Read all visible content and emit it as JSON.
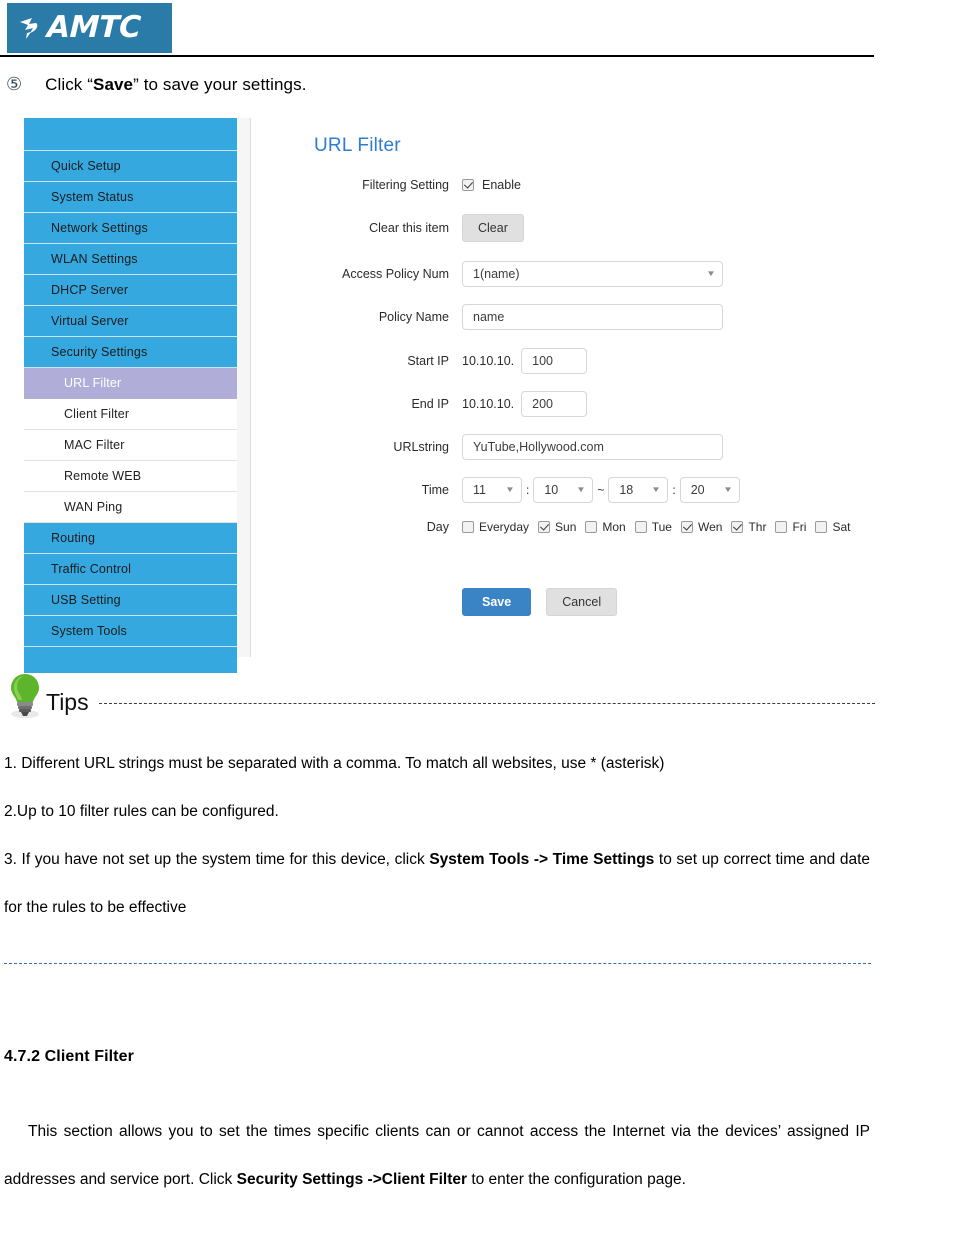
{
  "header": {
    "logo_text": "AMTC",
    "logo_bg": "#2b7ba8"
  },
  "step": {
    "number": "⑤",
    "text_before": "Click “",
    "bold": "Save",
    "text_after": "” to save your settings."
  },
  "router_ui": {
    "help_icon_label": "?",
    "panel_title": "URL Filter",
    "sidebar": {
      "items": [
        {
          "label": "Quick Setup",
          "type": "top",
          "active": false
        },
        {
          "label": "System Status",
          "type": "top",
          "active": false
        },
        {
          "label": "Network Settings",
          "type": "top",
          "active": false
        },
        {
          "label": "WLAN Settings",
          "type": "top",
          "active": false
        },
        {
          "label": "DHCP Server",
          "type": "top",
          "active": false
        },
        {
          "label": "Virtual Server",
          "type": "top",
          "active": false
        },
        {
          "label": "Security Settings",
          "type": "top",
          "active": false
        },
        {
          "label": "URL Filter",
          "type": "sub",
          "active": true
        },
        {
          "label": "Client Filter",
          "type": "sub",
          "active": false
        },
        {
          "label": "MAC Filter",
          "type": "sub",
          "active": false
        },
        {
          "label": "Remote WEB",
          "type": "sub",
          "active": false
        },
        {
          "label": "WAN Ping",
          "type": "sub",
          "active": false
        },
        {
          "label": "Routing",
          "type": "top",
          "active": false
        },
        {
          "label": "Traffic Control",
          "type": "top",
          "active": false
        },
        {
          "label": "USB Setting",
          "type": "top",
          "active": false
        },
        {
          "label": "System Tools",
          "type": "top",
          "active": false
        }
      ],
      "active_bg": "#b0aed8",
      "bg": "#35a8e0"
    },
    "form": {
      "filtering_setting_label": "Filtering Setting",
      "enable_label": "Enable",
      "enable_checked": true,
      "clear_item_label": "Clear this item",
      "clear_button": "Clear",
      "access_policy_label": "Access Policy Num",
      "access_policy_value": "1(name)",
      "policy_name_label": "Policy Name",
      "policy_name_value": "name",
      "start_ip_label": "Start IP",
      "start_ip_prefix": "10.10.10.",
      "start_ip_value": "100",
      "end_ip_label": "End IP",
      "end_ip_prefix": "10.10.10.",
      "end_ip_value": "200",
      "urlstring_label": "URLstring",
      "urlstring_value": "YuTube,Hollywood.com",
      "time_label": "Time",
      "time_start_hour": "11",
      "time_start_min": "10",
      "time_range_sep": "~",
      "time_end_hour": "18",
      "time_end_min": "20",
      "colon": ":",
      "day_label": "Day",
      "days": [
        {
          "label": "Everyday",
          "checked": false
        },
        {
          "label": "Sun",
          "checked": true
        },
        {
          "label": "Mon",
          "checked": false
        },
        {
          "label": "Tue",
          "checked": false
        },
        {
          "label": "Wen",
          "checked": true
        },
        {
          "label": "Thr",
          "checked": true
        },
        {
          "label": "Fri",
          "checked": false
        },
        {
          "label": "Sat",
          "checked": false
        }
      ],
      "save_button": "Save",
      "cancel_button": "Cancel",
      "save_color": "#3a83c4"
    }
  },
  "tips": {
    "label": "Tips",
    "items": [
      {
        "parts": [
          {
            "t": "1. Different URL strings must be separated with a comma. To match all websites, use * (asterisk)",
            "b": false
          }
        ]
      },
      {
        "parts": [
          {
            "t": "2.Up to 10 filter rules can be configured.",
            "b": false
          }
        ]
      },
      {
        "parts": [
          {
            "t": "3. If you have not set up the system time for this device, click ",
            "b": false
          },
          {
            "t": "System Tools -> Time Settings",
            "b": true
          },
          {
            "t": " to set up correct time and date for the rules to be effective",
            "b": false
          }
        ]
      }
    ]
  },
  "section": {
    "heading": "4.7.2 Client Filter",
    "paragraph_parts": [
      {
        "t": "This section allows you to set the times specific clients can or cannot access the Internet via the devices’ assigned IP addresses and service port. Click ",
        "b": false
      },
      {
        "t": "Security Settings ->Client Filter",
        "b": true
      },
      {
        "t": " to enter the configuration page.",
        "b": false
      }
    ]
  }
}
